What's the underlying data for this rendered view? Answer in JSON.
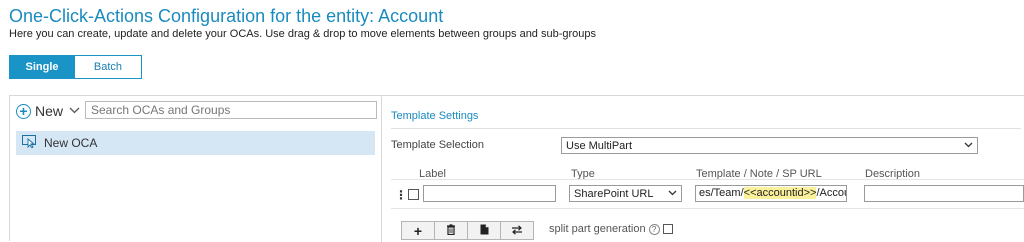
{
  "page": {
    "title": "One-Click-Actions Configuration for the entity: Account",
    "subtitle": "Here you can create, update and delete your OCAs. Use drag & drop to move elements between groups and sub-groups"
  },
  "mode_toggle": {
    "single": "Single",
    "batch": "Batch",
    "active": "single"
  },
  "left_panel": {
    "new_label": "New",
    "search_placeholder": "Search OCAs and Groups",
    "items": [
      {
        "label": "New OCA",
        "icon": "oca-icon"
      }
    ]
  },
  "template_settings": {
    "title": "Template Settings",
    "selection_label": "Template Selection",
    "selection_value": "Use MultiPart",
    "columns": {
      "label": "Label",
      "type": "Type",
      "url": "Template / Note / SP URL",
      "description": "Description"
    },
    "row": {
      "label_value": "",
      "type_value": "SharePoint URL",
      "url_prefix": "es/Team/",
      "url_highlight": "<<accountid>>",
      "url_suffix": "/AccountF",
      "description_value": ""
    },
    "buttons": {
      "add": "+",
      "delete": "🗑",
      "document": "▙",
      "swap": "⇄"
    },
    "split_label": "split part generation",
    "help_symbol": "?"
  },
  "colors": {
    "accent": "#1a94c6",
    "selected_item": "#d5e6f4",
    "highlight": "#fbf19a"
  }
}
